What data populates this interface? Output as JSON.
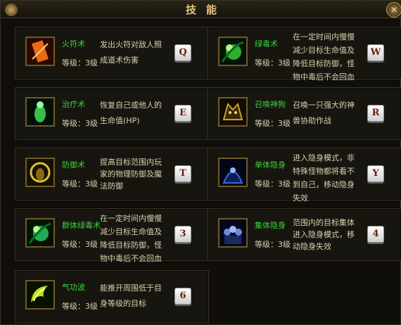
{
  "window": {
    "title": "技能",
    "close_icon": "close-icon"
  },
  "skills": [
    {
      "name": "火符术",
      "level": "等级：3级",
      "desc": [
        "发出火符对敌人照",
        "成道术伤害"
      ],
      "key": "Q",
      "icon": "fire-talisman-icon",
      "color": "#e86a1a"
    },
    {
      "name": "绿毒术",
      "level": "等级：3级",
      "desc": [
        "在一定时间内慢慢",
        "减少目标生命值及",
        "降低目标防御，怪",
        "物中毒后不会回血"
      ],
      "key": "W",
      "icon": "green-poison-icon",
      "color": "#3bd23a"
    },
    {
      "name": "治疗术",
      "level": "等级：3级",
      "desc": [
        "恢复自己或他人的",
        "生命值(HP)"
      ],
      "key": "E",
      "icon": "heal-icon",
      "color": "#38c048"
    },
    {
      "name": "召唤神狗",
      "level": "等级：3级",
      "desc": [
        "召唤一只强大的神",
        "兽协助作战"
      ],
      "key": "R",
      "icon": "summon-beast-icon",
      "color": "#d0a020"
    },
    {
      "name": "防御术",
      "level": "等级：3级",
      "desc": [
        "提高目标范围内玩",
        "家的物理防御及魔",
        "法防御"
      ],
      "key": "T",
      "icon": "defense-icon",
      "color": "#e0c030"
    },
    {
      "name": "单体隐身",
      "level": "等级：3级",
      "desc": [
        "进入隐身模式，非",
        "特殊怪物都将看不",
        "到自己，移动隐身",
        "失效"
      ],
      "key": "Y",
      "icon": "stealth-icon",
      "color": "#3a6adf"
    },
    {
      "name": "群体绿毒术",
      "level": "等级：3级",
      "desc": [
        "在一定时间内慢慢",
        "减少目标生命值及",
        "降低目标防御，怪",
        "物中毒后不会回血"
      ],
      "key": "3",
      "icon": "mass-poison-icon",
      "color": "#2fcf6a"
    },
    {
      "name": "集体隐身",
      "level": "等级：3级",
      "desc": [
        "范围内的目标集体",
        "进入隐身模式，移",
        "动隐身失效"
      ],
      "key": "4",
      "icon": "mass-stealth-icon",
      "color": "#6a8adf"
    },
    {
      "name": "气功波",
      "level": "等级：3级",
      "desc": [
        "能推开周围低于目",
        "身等级的目标"
      ],
      "key": "6",
      "icon": "qigong-wave-icon",
      "color": "#b8e020"
    }
  ]
}
